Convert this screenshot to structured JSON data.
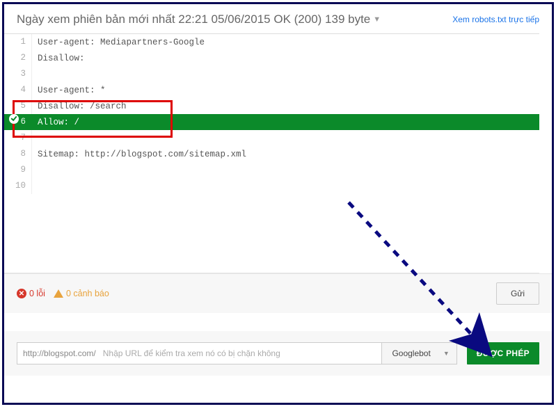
{
  "header": {
    "title": "Ngày xem phiên bản mới nhất 22:21 05/06/2015 OK (200) 139 byte",
    "link": "Xem robots.txt trực tiếp"
  },
  "editor": {
    "lines": [
      "User-agent: Mediapartners-Google",
      "Disallow:",
      "",
      "User-agent: *",
      "Disallow: /search",
      "Allow: /",
      "",
      "Sitemap: http://blogspot.com/sitemap.xml",
      "",
      ""
    ],
    "highlight_index": 5
  },
  "status": {
    "errors_label": "0 lỗi",
    "warnings_label": "0 cảnh báo",
    "submit_button": "Gửi"
  },
  "test": {
    "url_prefix": "http://blogspot.com/",
    "placeholder": "Nhập URL để kiểm tra xem nó có bị chặn không",
    "bot_selected": "Googlebot",
    "result": "ĐƯỢC PHÉP"
  }
}
